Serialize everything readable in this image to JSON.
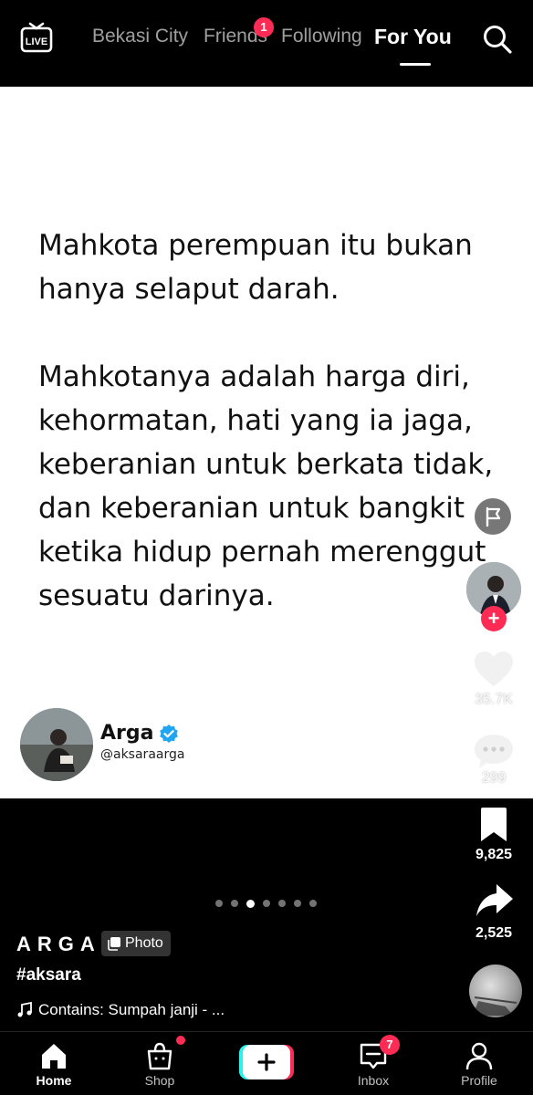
{
  "top_tabs": {
    "live_label": "LIVE",
    "tabs": [
      {
        "label": "Bekasi City"
      },
      {
        "label": "Friends",
        "badge": "1"
      },
      {
        "label": "Following"
      },
      {
        "label": "For You",
        "active": true
      }
    ]
  },
  "post": {
    "quote_paragraphs": [
      "Mahkota perempuan itu bukan hanya selaput darah.",
      "Mahkotanya adalah harga diri, kehormatan, hati yang ia jaga, keberanian untuk berkata tidak, dan keberanian untuk bangkit ketika hidup pernah merenggut sesuatu darinya."
    ],
    "author_name": "Arga",
    "author_handle": "@aksaraarga"
  },
  "rail": {
    "likes": "35.7K",
    "comments": "299",
    "saves": "9,825",
    "shares": "2,525"
  },
  "carousel": {
    "count": 7,
    "active_index": 2
  },
  "caption": {
    "creator": "ARGA",
    "photo_chip": "Photo",
    "hashtag": "#aksara",
    "music": "Contains: Sumpah janji - ..."
  },
  "bottom_nav": {
    "home": "Home",
    "shop": "Shop",
    "inbox": "Inbox",
    "inbox_badge": "7",
    "profile": "Profile"
  },
  "colors": {
    "accent": "#fe2c55",
    "background": "#000000",
    "card": "#ffffff",
    "verified": "#20a5f0"
  }
}
